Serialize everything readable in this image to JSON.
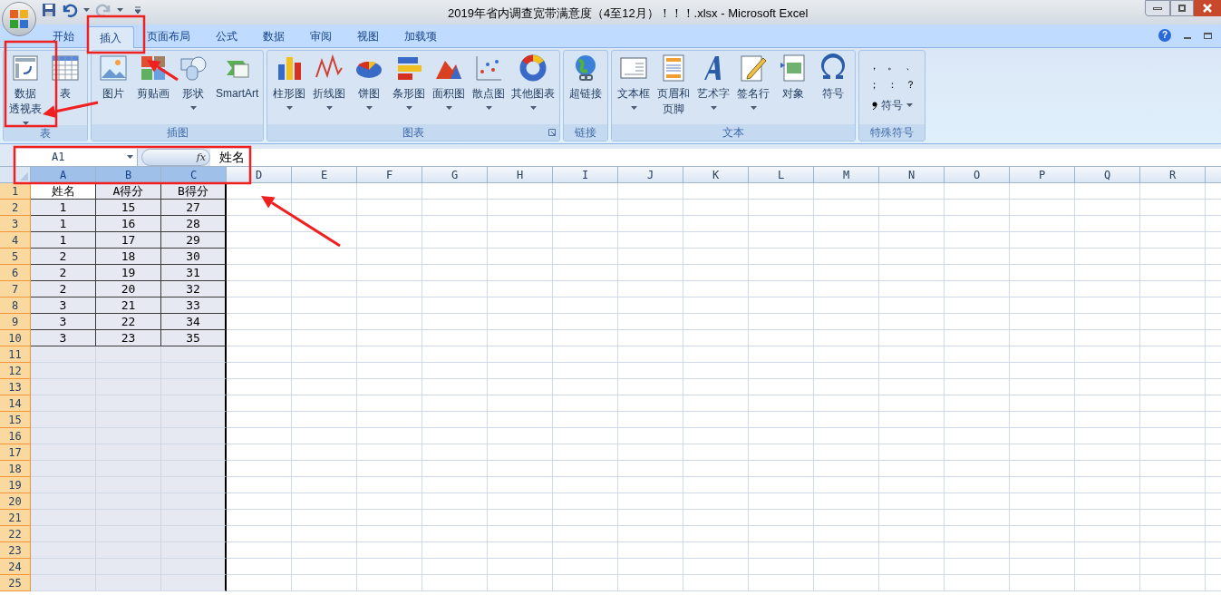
{
  "window": {
    "title": "2019年省内调查宽带满意度（4至12月）！！！.xlsx - Microsoft Excel"
  },
  "tabs": [
    {
      "label": "开始",
      "selected": false
    },
    {
      "label": "插入",
      "selected": true
    },
    {
      "label": "页面布局",
      "selected": false
    },
    {
      "label": "公式",
      "selected": false
    },
    {
      "label": "数据",
      "selected": false
    },
    {
      "label": "审阅",
      "selected": false
    },
    {
      "label": "视图",
      "selected": false
    },
    {
      "label": "加载项",
      "selected": false
    }
  ],
  "ribbon": [
    {
      "label": "表",
      "launcher": false,
      "buttons": [
        {
          "lines": [
            "数据",
            "透视表"
          ],
          "dropdown": true
        },
        {
          "lines": [
            "表"
          ],
          "dropdown": false
        }
      ]
    },
    {
      "label": "插图",
      "launcher": false,
      "buttons": [
        {
          "lines": [
            "图片"
          ],
          "dropdown": false
        },
        {
          "lines": [
            "剪贴画"
          ],
          "dropdown": false
        },
        {
          "lines": [
            "形状"
          ],
          "dropdown": true
        },
        {
          "lines": [
            "SmartArt"
          ],
          "dropdown": false
        }
      ]
    },
    {
      "label": "图表",
      "launcher": true,
      "buttons": [
        {
          "lines": [
            "柱形图"
          ],
          "dropdown": true
        },
        {
          "lines": [
            "折线图"
          ],
          "dropdown": true
        },
        {
          "lines": [
            "饼图"
          ],
          "dropdown": true
        },
        {
          "lines": [
            "条形图"
          ],
          "dropdown": true
        },
        {
          "lines": [
            "面积图"
          ],
          "dropdown": true
        },
        {
          "lines": [
            "散点图"
          ],
          "dropdown": true
        },
        {
          "lines": [
            "其他图表"
          ],
          "dropdown": true
        }
      ]
    },
    {
      "label": "链接",
      "launcher": false,
      "buttons": [
        {
          "lines": [
            "超链接"
          ],
          "dropdown": false
        }
      ]
    },
    {
      "label": "文本",
      "launcher": false,
      "buttons": [
        {
          "lines": [
            "文本框"
          ],
          "dropdown": true
        },
        {
          "lines": [
            "页眉和",
            "页脚"
          ],
          "dropdown": false
        },
        {
          "lines": [
            "艺术字"
          ],
          "dropdown": true
        },
        {
          "lines": [
            "签名行"
          ],
          "dropdown": true
        },
        {
          "lines": [
            "对象"
          ],
          "dropdown": false
        },
        {
          "lines": [
            "符号"
          ],
          "dropdown": false
        }
      ]
    }
  ],
  "special_symbols": {
    "label": "特殊符号",
    "symbols": [
      "，",
      "。",
      "、",
      "；",
      "：",
      "？"
    ],
    "button": "符号"
  },
  "help": "?",
  "formula_bar": {
    "name_box": "A1",
    "function_label": "fx",
    "value": "姓名"
  },
  "columns": [
    {
      "label": "A",
      "selected": true
    },
    {
      "label": "B",
      "selected": true
    },
    {
      "label": "C",
      "selected": true
    },
    {
      "label": "D",
      "selected": false
    },
    {
      "label": "E",
      "selected": false
    },
    {
      "label": "F",
      "selected": false
    },
    {
      "label": "G",
      "selected": false
    },
    {
      "label": "H",
      "selected": false
    },
    {
      "label": "I",
      "selected": false
    },
    {
      "label": "J",
      "selected": false
    },
    {
      "label": "K",
      "selected": false
    },
    {
      "label": "L",
      "selected": false
    },
    {
      "label": "M",
      "selected": false
    },
    {
      "label": "N",
      "selected": false
    },
    {
      "label": "O",
      "selected": false
    },
    {
      "label": "P",
      "selected": false
    },
    {
      "label": "Q",
      "selected": false
    },
    {
      "label": "R",
      "selected": false
    }
  ],
  "rows": [
    {
      "label": "1",
      "selected": true,
      "cells": [
        "姓名",
        "A得分",
        "B得分"
      ]
    },
    {
      "label": "2",
      "selected": true,
      "cells": [
        "1",
        "15",
        "27"
      ]
    },
    {
      "label": "3",
      "selected": true,
      "cells": [
        "1",
        "16",
        "28"
      ]
    },
    {
      "label": "4",
      "selected": true,
      "cells": [
        "1",
        "17",
        "29"
      ]
    },
    {
      "label": "5",
      "selected": true,
      "cells": [
        "2",
        "18",
        "30"
      ]
    },
    {
      "label": "6",
      "selected": true,
      "cells": [
        "2",
        "19",
        "31"
      ]
    },
    {
      "label": "7",
      "selected": true,
      "cells": [
        "2",
        "20",
        "32"
      ]
    },
    {
      "label": "8",
      "selected": true,
      "cells": [
        "3",
        "21",
        "33"
      ]
    },
    {
      "label": "9",
      "selected": true,
      "cells": [
        "3",
        "22",
        "34"
      ]
    },
    {
      "label": "10",
      "selected": true,
      "cells": [
        "3",
        "23",
        "35"
      ]
    },
    {
      "label": "11",
      "selected": true,
      "cells": []
    },
    {
      "label": "12",
      "selected": true,
      "cells": []
    },
    {
      "label": "13",
      "selected": true,
      "cells": []
    },
    {
      "label": "14",
      "selected": true,
      "cells": []
    },
    {
      "label": "15",
      "selected": true,
      "cells": []
    },
    {
      "label": "16",
      "selected": true,
      "cells": []
    },
    {
      "label": "17",
      "selected": true,
      "cells": []
    },
    {
      "label": "18",
      "selected": true,
      "cells": []
    },
    {
      "label": "19",
      "selected": true,
      "cells": []
    },
    {
      "label": "20",
      "selected": true,
      "cells": []
    },
    {
      "label": "21",
      "selected": true,
      "cells": []
    },
    {
      "label": "22",
      "selected": true,
      "cells": []
    },
    {
      "label": "23",
      "selected": true,
      "cells": []
    },
    {
      "label": "24",
      "selected": true,
      "cells": []
    },
    {
      "label": "25",
      "selected": true,
      "cells": []
    }
  ]
}
